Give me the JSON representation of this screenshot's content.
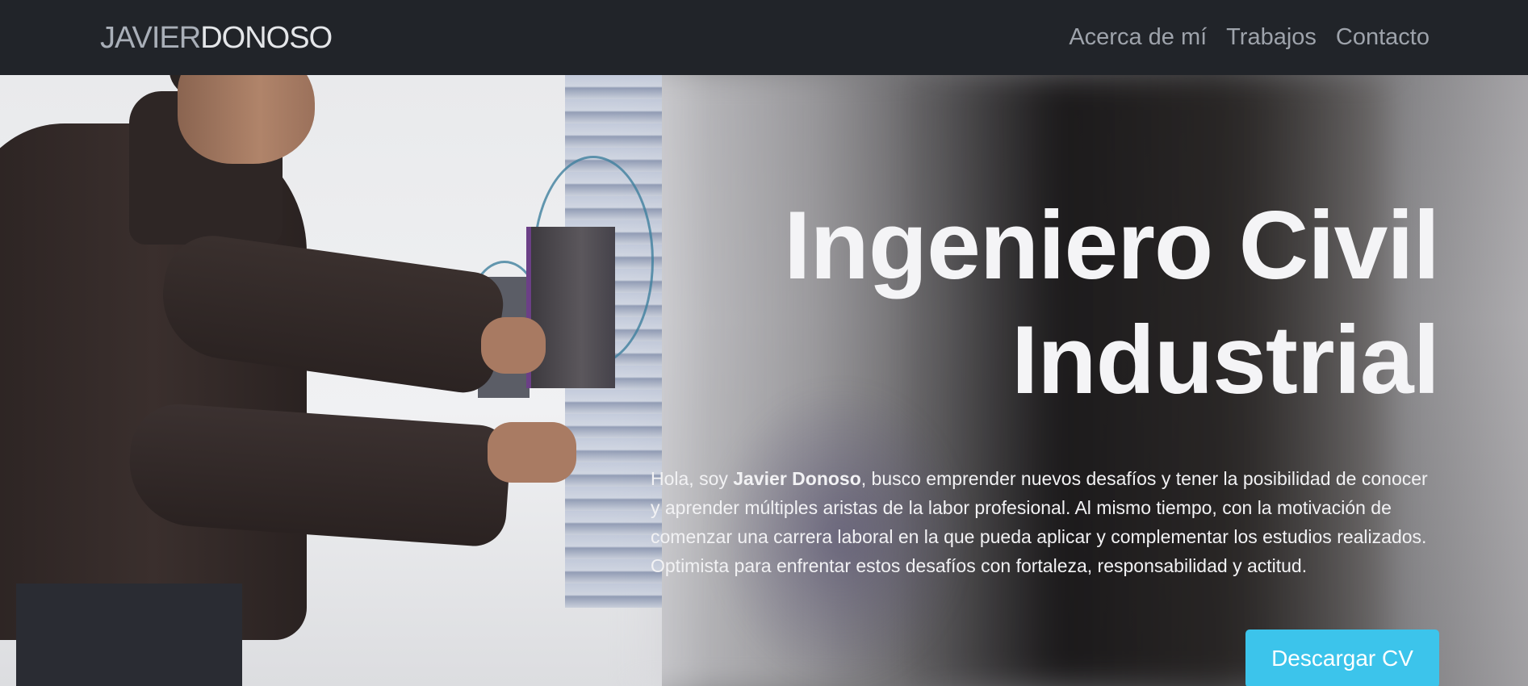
{
  "navbar": {
    "brand_first": "JAVIER",
    "brand_last": "DONOSO",
    "links": [
      {
        "label": "Acerca de mí"
      },
      {
        "label": "Trabajos"
      },
      {
        "label": "Contacto"
      }
    ]
  },
  "hero": {
    "title_line1": "Ingeniero Civil",
    "title_line2": "Industrial",
    "intro_before": "Hola, soy ",
    "intro_name": "Javier Donoso",
    "intro_after": ", busco emprender nuevos desafíos y tener la posibilidad de conocer y aprender múltiples aristas de la labor profesional. Al mismo tiempo, con la motivación de comenzar una carrera laboral en la que pueda aplicar y complementar los estudios realizados. Optimista para enfrentar estos desafíos con fortaleza, responsabilidad y actitud.",
    "button_label": "Descargar CV"
  },
  "colors": {
    "navbar_bg": "#212429",
    "button_bg": "#3cc4eb",
    "text_light": "#f4f4f6"
  }
}
